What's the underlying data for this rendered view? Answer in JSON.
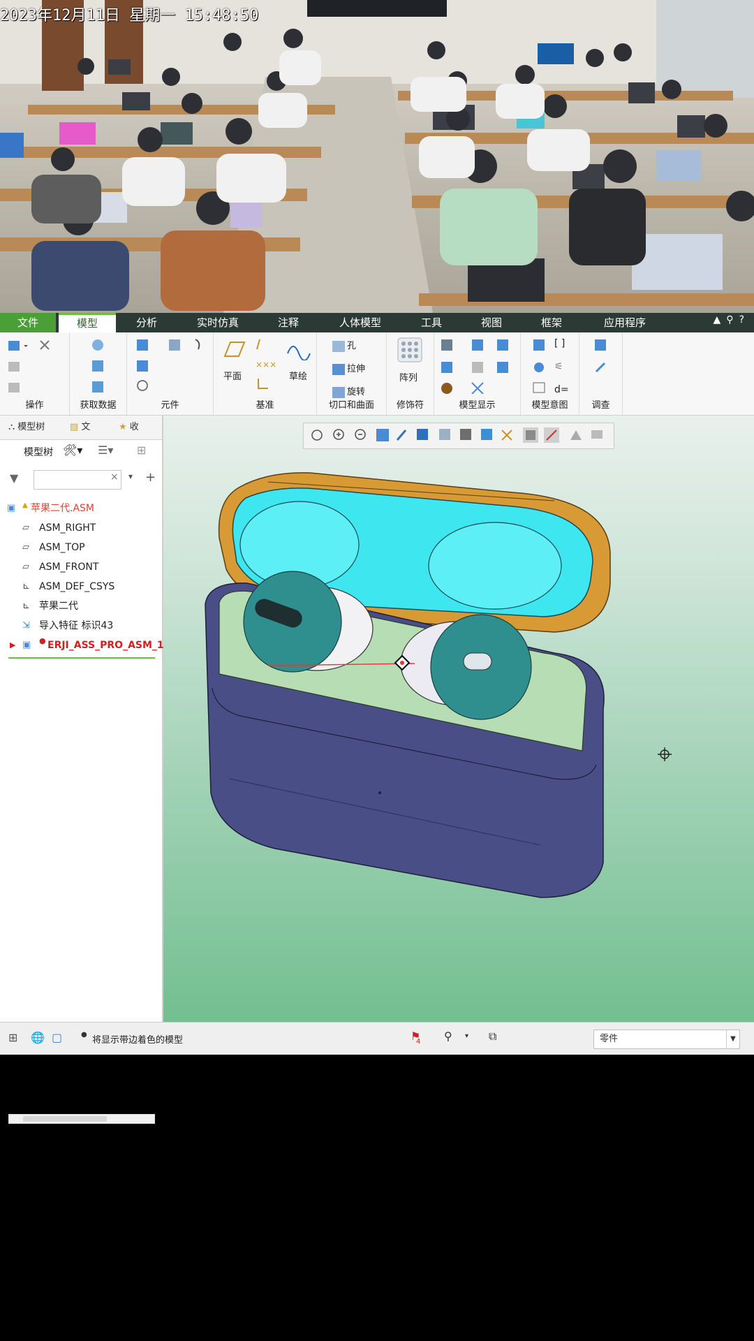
{
  "overlay": {
    "timestamp": "2023年12月11日 星期一 15:48:50"
  },
  "menu": {
    "tabs": [
      "文件",
      "模型",
      "分析",
      "实时仿真",
      "注释",
      "人体模型",
      "工具",
      "视图",
      "框架",
      "应用程序"
    ],
    "active": "模型"
  },
  "ribbon": {
    "groups": {
      "operations": "操作",
      "get_data": "获取数据",
      "component": "元件",
      "datum": "基准",
      "cut_surface": "切口和曲面",
      "modifier": "修饰符",
      "model_display": "模型显示",
      "model_intent": "模型意图",
      "investigate": "调查"
    },
    "buttons": {
      "plane": "平面",
      "sketch": "草绘",
      "hole": "孔",
      "extrude": "拉伸",
      "revolve": "旋转",
      "pattern": "阵列",
      "relations": "d="
    }
  },
  "tree": {
    "tabs": [
      "模型树",
      "文",
      "收"
    ],
    "toolbar_label": "模型树",
    "items": [
      {
        "label": "苹果二代.ASM",
        "icon": "assembly-icon"
      },
      {
        "label": "ASM_RIGHT",
        "icon": "datum-plane-icon"
      },
      {
        "label": "ASM_TOP",
        "icon": "datum-plane-icon"
      },
      {
        "label": "ASM_FRONT",
        "icon": "datum-plane-icon"
      },
      {
        "label": "ASM_DEF_CSYS",
        "icon": "csys-icon"
      },
      {
        "label": "苹果二代",
        "icon": "csys-icon"
      },
      {
        "label": "导入特征 标识43",
        "icon": "import-feature-icon"
      },
      {
        "label": "ERJI_ASS_PRO_ASM_1",
        "icon": "subassembly-icon"
      }
    ]
  },
  "status": {
    "message": "将显示带边着色的模型",
    "flag_count": "4",
    "filter_value": "零件"
  },
  "colors": {
    "menubar": "#2c3a36",
    "accent": "#6cbd45",
    "case_lid": "#d79a35",
    "case_inner": "#3ee6f0",
    "case_body": "#4a4e86",
    "earbud_cap": "#2f8f8f"
  }
}
